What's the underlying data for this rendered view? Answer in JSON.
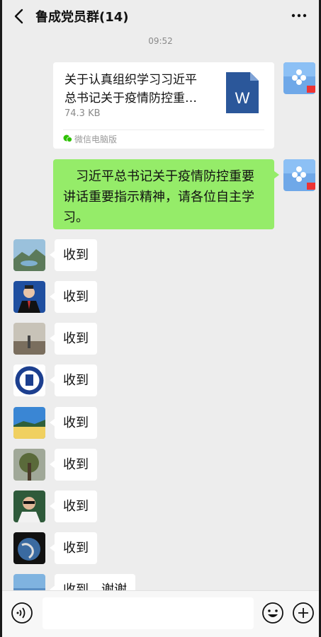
{
  "header": {
    "title": "鲁成党员群(14)",
    "back_icon": "back-arrow-icon",
    "more_icon": "more-icon"
  },
  "timestamp": "09:52",
  "messages": {
    "file": {
      "title_line1": "关于认真组织学习习近平",
      "title_line2": "总书记关于疫情防控重…",
      "size": "74.3 KB",
      "source": "微信电脑版",
      "file_icon": "word-document-icon"
    },
    "text": {
      "line1": "　习近平总书记关于疫情防控重要",
      "line2": "讲话重要指示精神，请各位自主学",
      "line3": "习。"
    },
    "replies": [
      "收到",
      "收到",
      "收到",
      "收到",
      "收到",
      "收到",
      "收到",
      "收到",
      "收到，谢谢"
    ]
  },
  "colors": {
    "background": "#ededed",
    "sent_bubble": "#95ec69",
    "received_bubble": "#ffffff"
  }
}
